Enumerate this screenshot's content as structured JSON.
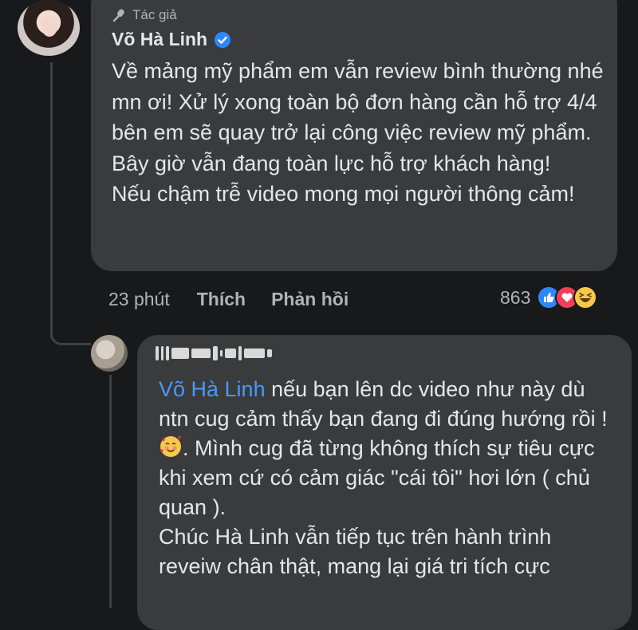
{
  "comment": {
    "badge": "Tác giả",
    "author": "Võ Hà Linh",
    "lines": [
      "Về mảng mỹ phẩm em vẫn review bình thường nhé mn ơi! Xử lý xong toàn bộ đơn hàng cần hỗ trợ 4/4 bên em sẽ quay trở lại công việc review mỹ phẩm. Bây giờ vẫn đang toàn lực hỗ trợ khách hàng!",
      "Nếu chậm trễ video mong mọi người thông cảm!"
    ],
    "time": "23 phút",
    "like_label": "Thích",
    "reply_label": "Phản hồi",
    "reaction_count": "863"
  },
  "reply": {
    "mention": "Võ Hà Linh",
    "text_before_emoji": " nếu bạn lên dc video như này dù ntn cug cảm thấy bạn đang đi đúng hướng rồi ! ",
    "text_after_emoji": ". Mình cug đã từng không thích sự tiêu cực khi xem cứ có cảm giác \"cái tôi\" hơi lớn ( chủ quan ).",
    "line2": "Chúc Hà Linh vẫn tiếp tục trên hành trình reveiw chân thật, mang lại giá tri tích cực"
  },
  "colors": {
    "background": "#18191a",
    "bubble": "#3a3b3c",
    "mention": "#4599ff",
    "verified": "#2d88ff"
  },
  "icons": [
    "mic-icon",
    "verified-badge-icon",
    "like-reaction-icon",
    "love-reaction-icon",
    "haha-reaction-icon",
    "smiling-hearts-emoji"
  ]
}
